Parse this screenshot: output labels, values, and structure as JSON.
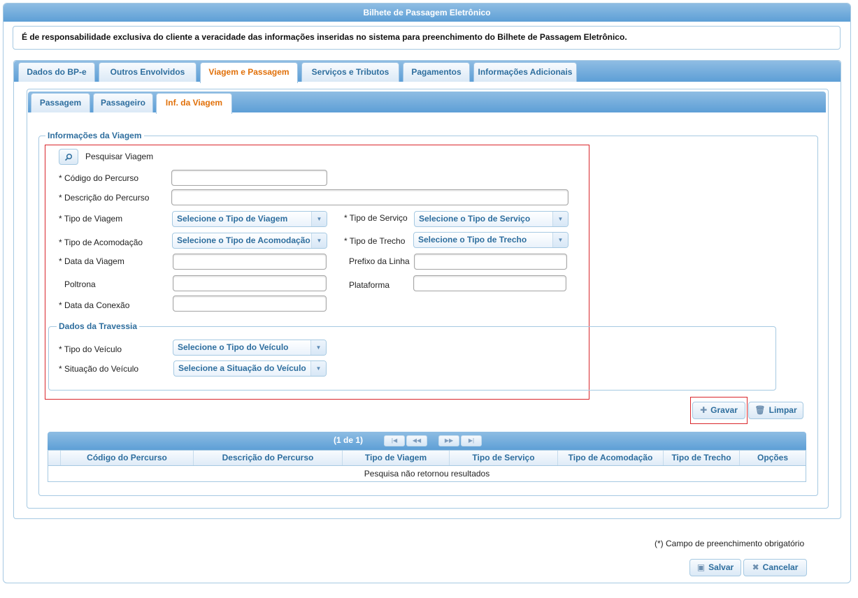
{
  "window": {
    "title": "Bilhete de Passagem Eletrônico"
  },
  "disclaimer": "É de responsabilidade exclusiva do cliente a veracidade das informações inseridas no sistema para preenchimento do Bilhete de Passagem Eletrônico.",
  "main_tabs": [
    {
      "label": "Dados do BP-e",
      "active": false
    },
    {
      "label": "Outros Envolvidos",
      "active": false
    },
    {
      "label": "Viagem e Passagem",
      "active": true
    },
    {
      "label": "Serviços e Tributos",
      "active": false
    },
    {
      "label": "Pagamentos",
      "active": false
    },
    {
      "label": "Informações Adicionais",
      "active": false
    }
  ],
  "sub_tabs": [
    {
      "label": "Passagem",
      "active": false
    },
    {
      "label": "Passageiro",
      "active": false
    },
    {
      "label": "Inf. da Viagem",
      "active": true
    }
  ],
  "trip_info": {
    "legend": "Informações da Viagem",
    "search_label": "Pesquisar Viagem",
    "fields": {
      "codigo_percurso": {
        "label": "* Código do Percurso",
        "value": ""
      },
      "descricao_percurso": {
        "label": "* Descrição do Percurso",
        "value": ""
      },
      "tipo_viagem": {
        "label": "* Tipo de Viagem",
        "value": "Selecione o Tipo de Viagem"
      },
      "tipo_servico": {
        "label": "* Tipo de Serviço",
        "value": "Selecione o Tipo de Serviço"
      },
      "tipo_acomodacao": {
        "label": "* Tipo de Acomodação",
        "value": "Selecione o Tipo de Acomodação"
      },
      "tipo_trecho": {
        "label": "* Tipo de Trecho",
        "value": "Selecione o Tipo de Trecho"
      },
      "data_viagem": {
        "label": "* Data da Viagem",
        "value": ""
      },
      "prefixo_linha": {
        "label": "Prefixo da Linha",
        "value": ""
      },
      "poltrona": {
        "label": "Poltrona",
        "value": ""
      },
      "plataforma": {
        "label": "Plataforma",
        "value": ""
      },
      "data_conexao": {
        "label": "* Data da Conexão",
        "value": ""
      }
    }
  },
  "crossing": {
    "legend": "Dados da Travessia",
    "tipo_veiculo": {
      "label": "* Tipo do Veículo",
      "value": "Selecione o Tipo do Veículo"
    },
    "situacao_veiculo": {
      "label": "* Situação do Veículo",
      "value": "Selecione a Situação do Veículo"
    }
  },
  "actions": {
    "gravar": "Gravar",
    "limpar": "Limpar"
  },
  "grid": {
    "pager": "(1 de 1)",
    "columns": [
      "Código do Percurso",
      "Descrição do Percurso",
      "Tipo de Viagem",
      "Tipo de Serviço",
      "Tipo de Acomodação",
      "Tipo de Trecho",
      "Opções"
    ],
    "empty_message": "Pesquisa não retornou resultados"
  },
  "footer": {
    "note": "(*) Campo de preenchimento obrigatório",
    "salvar": "Salvar",
    "cancelar": "Cancelar"
  },
  "icons": {
    "search": "search-icon",
    "dropdown": "chevron-down-icon",
    "add": "plus-icon",
    "trash": "trash-icon",
    "save": "floppy-icon",
    "cancel": "close-icon"
  }
}
